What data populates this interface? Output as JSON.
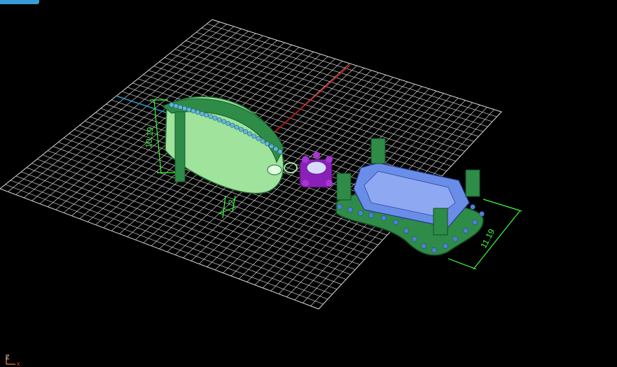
{
  "viewport": {
    "dimensions": {
      "height": "10.19",
      "width": "11.19",
      "gauge": "2"
    },
    "axes": {
      "z": "Z",
      "x": "x"
    },
    "colors": {
      "background": "#000000",
      "grid": "#d8d8d8",
      "x_axis": "#cc1b1b",
      "y_axis": "#2f8fc4",
      "model_green": "#2e8b48",
      "model_light": "#8fe58f",
      "gem_blue": "#5a7fe0",
      "purple_part": "#8a20b8",
      "dimension": "#3bff3b"
    },
    "icons": [
      "axis-gizmo-icon"
    ]
  }
}
